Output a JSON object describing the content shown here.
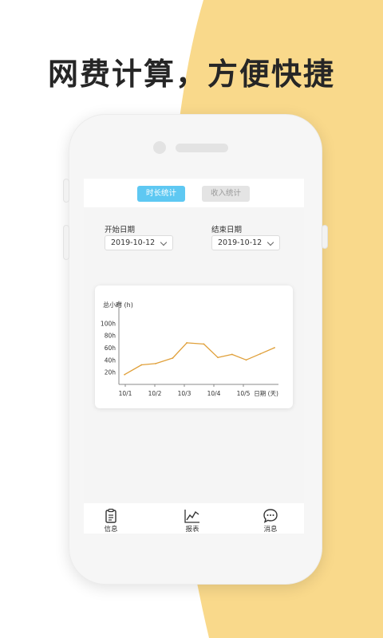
{
  "headline": "网费计算，方便快捷",
  "colors": {
    "accent_bg": "#f9d98b",
    "tab_active": "#5ec8f2",
    "line": "#e0a03a"
  },
  "tabs": [
    {
      "label": "时长统计",
      "active": true
    },
    {
      "label": "收入统计",
      "active": false
    }
  ],
  "start_date": {
    "label": "开始日期",
    "value": "2019-10-12"
  },
  "end_date": {
    "label": "结束日期",
    "value": "2019-10-12"
  },
  "chart_data": {
    "type": "line",
    "ylabel": "总小时 (h)",
    "xlabel": "日期 (天)",
    "yticks": [
      20,
      40,
      60,
      80,
      100
    ],
    "ytick_labels": [
      "20h",
      "40h",
      "60h",
      "80h",
      "100h"
    ],
    "ylim": [
      0,
      120
    ],
    "xlim": [
      0,
      5.5
    ],
    "xticks": [
      0,
      1,
      2,
      3,
      4
    ],
    "xtick_labels": [
      "10/1",
      "10/2",
      "10/3",
      "10/4",
      "10/5"
    ],
    "grid": false,
    "series": [
      {
        "x": [
          0.2,
          0.8,
          1.3,
          1.9,
          2.4,
          3.0,
          3.5,
          4.0,
          4.5,
          5.0,
          5.5
        ],
        "y": [
          16,
          32,
          34,
          43,
          68,
          66,
          44,
          49,
          40,
          50,
          60
        ]
      }
    ]
  },
  "nav": [
    {
      "label": "信息",
      "icon": "clipboard-icon"
    },
    {
      "label": "报表",
      "icon": "chart-icon"
    },
    {
      "label": "消息",
      "icon": "chat-icon"
    }
  ]
}
